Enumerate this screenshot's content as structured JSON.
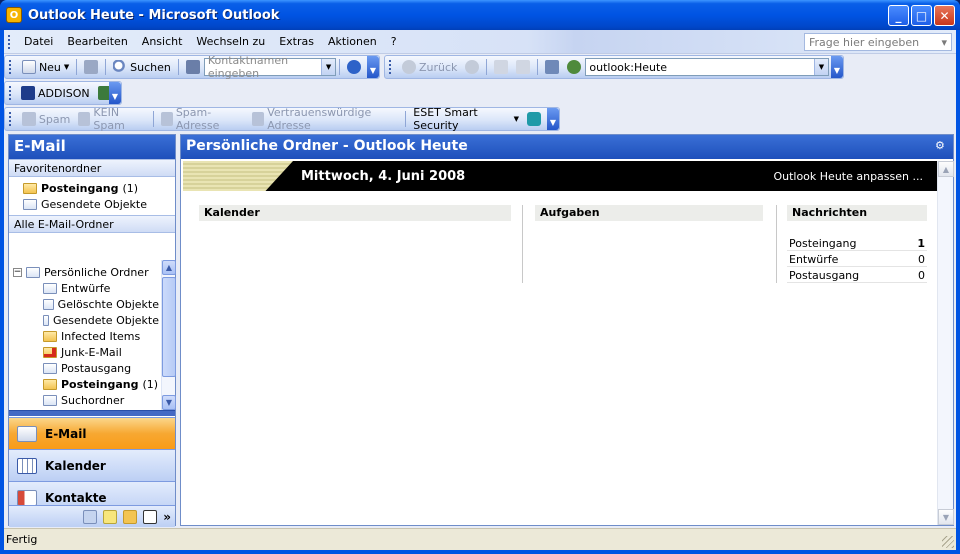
{
  "window": {
    "title": "Outlook Heute - Microsoft Outlook",
    "min": "_",
    "max": "□",
    "close": "✕"
  },
  "menu": {
    "items": [
      "Datei",
      "Bearbeiten",
      "Ansicht",
      "Wechseln zu",
      "Extras",
      "Aktionen",
      "?"
    ],
    "help_placeholder": "Frage hier eingeben"
  },
  "toolbar1": {
    "new_label": "Neu",
    "search_label": "Suchen",
    "contact_placeholder": "Kontaktnamen eingeben",
    "back_label": "Zurück",
    "address_value": "outlook:Heute"
  },
  "toolbar2": {
    "label": "ADDISON"
  },
  "toolbar3": {
    "spam": "Spam",
    "not_spam": "KEIN Spam",
    "spam_address": "Spam-Adresse",
    "trusted_address": "Vertrauenswürdige Adresse",
    "eset": "ESET Smart Security"
  },
  "nav": {
    "title": "E-Mail",
    "favorites_header": "Favoritenordner",
    "favorites": [
      {
        "label": "Posteingang",
        "count": "(1)",
        "bold": true
      },
      {
        "label": "Gesendete Objekte",
        "count": "",
        "bold": false
      }
    ],
    "all_header": "Alle E-Mail-Ordner",
    "tree_root": "Persönliche Ordner",
    "tree": [
      {
        "label": "Entwürfe",
        "count": ""
      },
      {
        "label": "Gelöschte Objekte",
        "count": ""
      },
      {
        "label": "Gesendete Objekte",
        "count": ""
      },
      {
        "label": "Infected Items",
        "count": ""
      },
      {
        "label": "Junk-E-Mail",
        "count": ""
      },
      {
        "label": "Postausgang",
        "count": ""
      },
      {
        "label": "Posteingang",
        "count": "(1)"
      },
      {
        "label": "Suchordner",
        "count": ""
      }
    ],
    "buttons": [
      "E-Mail",
      "Kalender",
      "Kontakte"
    ],
    "more": "»"
  },
  "main": {
    "title": "Persönliche Ordner - Outlook Heute",
    "date": "Mittwoch, 4. Juni 2008",
    "customize": "Outlook Heute anpassen ...",
    "calendar": "Kalender",
    "tasks": "Aufgaben",
    "messages": "Nachrichten",
    "message_rows": [
      {
        "label": "Posteingang",
        "count": "1"
      },
      {
        "label": "Entwürfe",
        "count": "0"
      },
      {
        "label": "Postausgang",
        "count": "0"
      }
    ]
  },
  "status": {
    "text": "Fertig"
  },
  "colors": {
    "accent": "#0054e3",
    "pane_header": "#1e50bb",
    "active_nav": "#f7a832"
  }
}
